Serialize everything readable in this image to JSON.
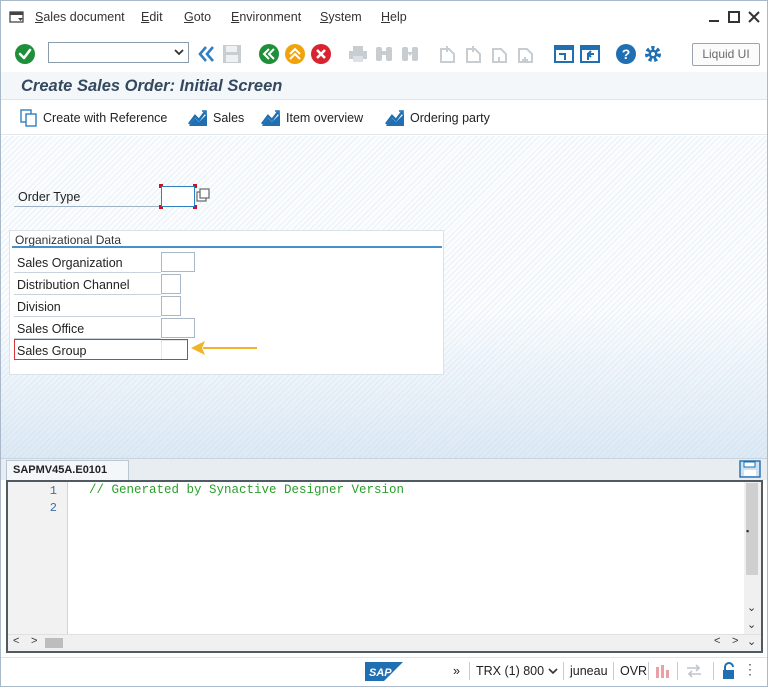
{
  "menu": {
    "items": [
      {
        "label": "Sales document",
        "u": "S",
        "rest": "ales document"
      },
      {
        "label": "Edit",
        "u": "E",
        "rest": "dit"
      },
      {
        "label": "Goto",
        "u": "G",
        "rest": "oto"
      },
      {
        "label": "Environment",
        "u": "E",
        "rest": "nvironment"
      },
      {
        "label": "System",
        "u": "S",
        "rest": "ystem"
      },
      {
        "label": "Help",
        "u": "H",
        "rest": "elp"
      }
    ]
  },
  "toolbar": {
    "command_value": "",
    "liquid_ui_label": "Liquid UI",
    "icons": [
      "enter-icon",
      "command-field",
      "back-double-icon",
      "save-icon",
      "back-icon",
      "exit-icon",
      "cancel-icon",
      "print-icon",
      "find-icon",
      "find-next-icon",
      "first-page-icon",
      "prev-page-icon",
      "next-page-icon",
      "last-page-icon",
      "new-session-icon",
      "shortcut-icon",
      "help-icon",
      "settings-icon"
    ]
  },
  "page": {
    "title": "Create Sales Order: Initial Screen"
  },
  "app_toolbar": {
    "create_with_reference": "Create with Reference",
    "sales": "Sales",
    "item_overview": "Item overview",
    "ordering_party": "Ordering party"
  },
  "form": {
    "order_type_label": "Order Type",
    "order_type_value": "",
    "org_group_title": "Organizational Data",
    "fields": [
      {
        "label": "Sales Organization",
        "value": ""
      },
      {
        "label": "Distribution Channel",
        "value": ""
      },
      {
        "label": "Division",
        "value": ""
      },
      {
        "label": "Sales Office",
        "value": ""
      },
      {
        "label": "Sales Group",
        "value": ""
      }
    ],
    "highlight_color": "#d8343c",
    "arrow_color": "#f0b429"
  },
  "editor": {
    "tab_label": "SAPMV45A.E0101",
    "lines": [
      {
        "no": "1",
        "text": "// Generated by Synactive Designer Version"
      },
      {
        "no": "2",
        "text": ""
      }
    ],
    "code_color": "#2aa02a"
  },
  "status": {
    "more": "»",
    "system": "TRX (1) 800",
    "user": "juneau",
    "mode": "OVR"
  },
  "colors": {
    "accent": "#2f7fc1",
    "title": "#34495e"
  }
}
